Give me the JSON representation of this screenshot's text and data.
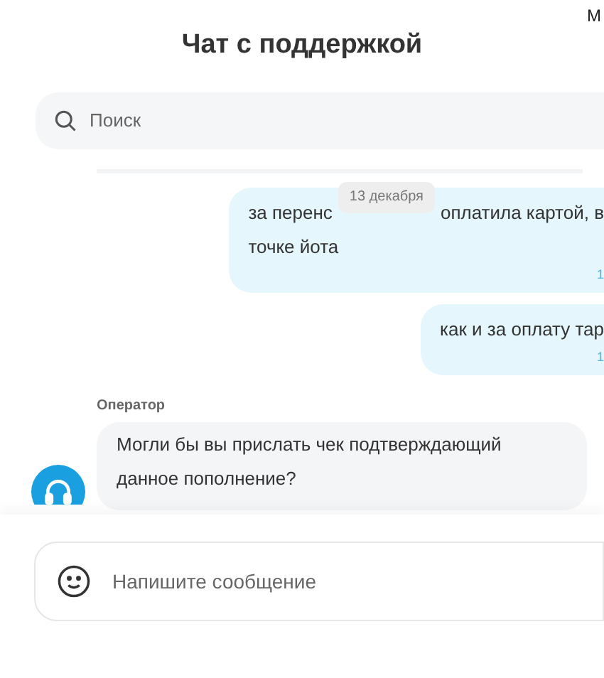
{
  "corner_text": "М",
  "title": "Чат с поддержкой",
  "search": {
    "placeholder": "Поиск"
  },
  "date_chip": "13 декабря",
  "messages": [
    {
      "kind": "outgoing",
      "line_parts": [
        "за перенс",
        "оплатила картой, в"
      ],
      "lines": [
        "точке йота"
      ],
      "time": "1"
    },
    {
      "kind": "outgoing",
      "line_parts": [
        "как и за оплату тар"
      ],
      "time": "1"
    },
    {
      "kind": "incoming",
      "sender": "Оператор",
      "line_parts": [
        "Могли бы вы прислать чек подтверждающий"
      ],
      "lines": [
        "данное пополнение?"
      ]
    }
  ],
  "composer": {
    "placeholder": "Напишите сообщение"
  }
}
